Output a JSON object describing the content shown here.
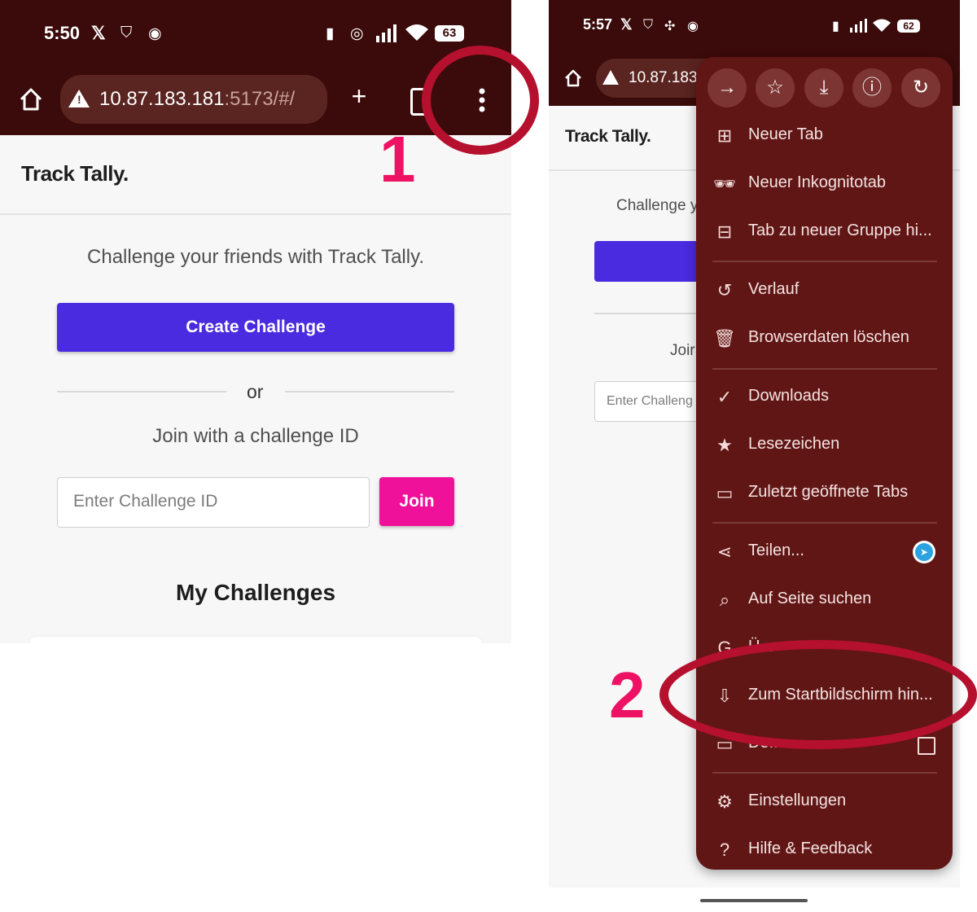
{
  "left_phone": {
    "status": {
      "time": "5:50",
      "battery": "63"
    },
    "toolbar": {
      "url_host": "10.87.183.181",
      "url_path": ":5173/#/"
    },
    "app_title": "Track Tally.",
    "tagline": "Challenge your friends with Track Tally.",
    "create_button": "Create Challenge",
    "or_text": "or",
    "join_prompt": "Join with a challenge ID",
    "challenge_input_placeholder": "Enter Challenge ID",
    "join_button": "Join",
    "section_title": "My Challenges"
  },
  "right_phone": {
    "status": {
      "time": "5:57",
      "battery": "62"
    },
    "toolbar": {
      "url_host": "10.87.183."
    },
    "app_title": "Track Tally.",
    "tagline_partial": "Challenge y",
    "join_partial": "Joir",
    "input_partial": "Enter Challeng"
  },
  "menu": {
    "top_icons": [
      "forward-icon",
      "star-icon",
      "download-icon",
      "info-icon",
      "reload-icon"
    ],
    "items": [
      {
        "icon": "new-tab-icon",
        "label": "Neuer Tab"
      },
      {
        "icon": "incognito-icon",
        "label": "Neuer Inkognitotab"
      },
      {
        "icon": "tab-group-icon",
        "label": "Tab zu neuer Gruppe hi..."
      },
      {
        "icon": "history-icon",
        "label": "Verlauf"
      },
      {
        "icon": "trash-icon",
        "label": "Browserdaten löschen"
      },
      {
        "icon": "downloads-icon",
        "label": "Downloads"
      },
      {
        "icon": "bookmark-star-icon",
        "label": "Lesezeichen"
      },
      {
        "icon": "recent-tabs-icon",
        "label": "Zuletzt geöffnete Tabs"
      },
      {
        "icon": "share-icon",
        "label": "Teilen..."
      },
      {
        "icon": "find-in-page-icon",
        "label": "Auf Seite suchen"
      },
      {
        "icon": "translate-icon",
        "label": "Ü..."
      },
      {
        "icon": "add-to-homescreen-icon",
        "label": "Zum Startbildschirm hin..."
      },
      {
        "icon": "desktop-site-icon",
        "label": "De..."
      },
      {
        "icon": "settings-icon",
        "label": "Einstellungen"
      },
      {
        "icon": "help-icon",
        "label": "Hilfe & Feedback"
      }
    ]
  },
  "annotations": {
    "step1": "1",
    "step2": "2",
    "ring_color": "#b5102e",
    "number_color": "#ee1264"
  },
  "colors": {
    "toolbar": "#3b0a0a",
    "menu_bg": "#611616",
    "primary": "#4a2be0",
    "accent": "#f0119a"
  }
}
